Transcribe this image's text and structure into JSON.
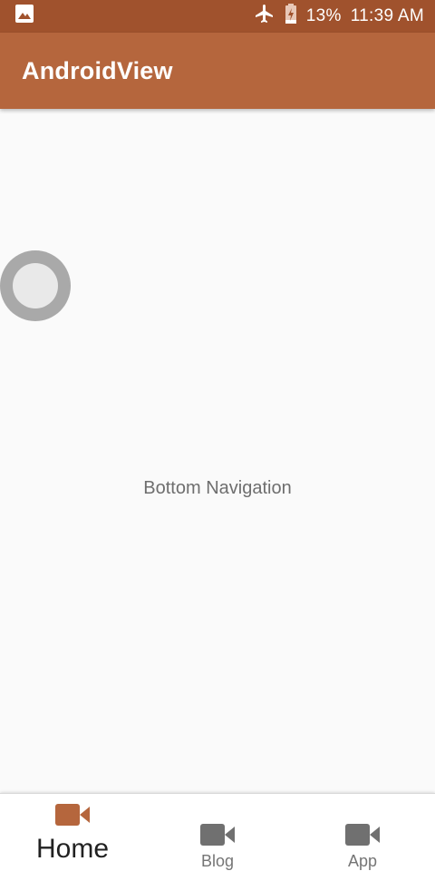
{
  "status_bar": {
    "battery": "13%",
    "time": "11:39 AM",
    "icons": [
      "image-icon",
      "airplane-icon",
      "battery-charging-icon"
    ]
  },
  "app_bar": {
    "title": "AndroidView"
  },
  "main": {
    "center_text": "Bottom Navigation"
  },
  "bottom_nav": {
    "items": [
      {
        "label": "Home",
        "icon": "videocam-icon",
        "active": true
      },
      {
        "label": "Blog",
        "icon": "videocam-icon",
        "active": false
      },
      {
        "label": "App",
        "icon": "videocam-icon",
        "active": false
      }
    ]
  },
  "colors": {
    "status_bar": "#a0522d",
    "app_bar": "#b5663d",
    "accent": "#b5663d",
    "inactive_icon": "#707070",
    "background": "#fafafa"
  }
}
